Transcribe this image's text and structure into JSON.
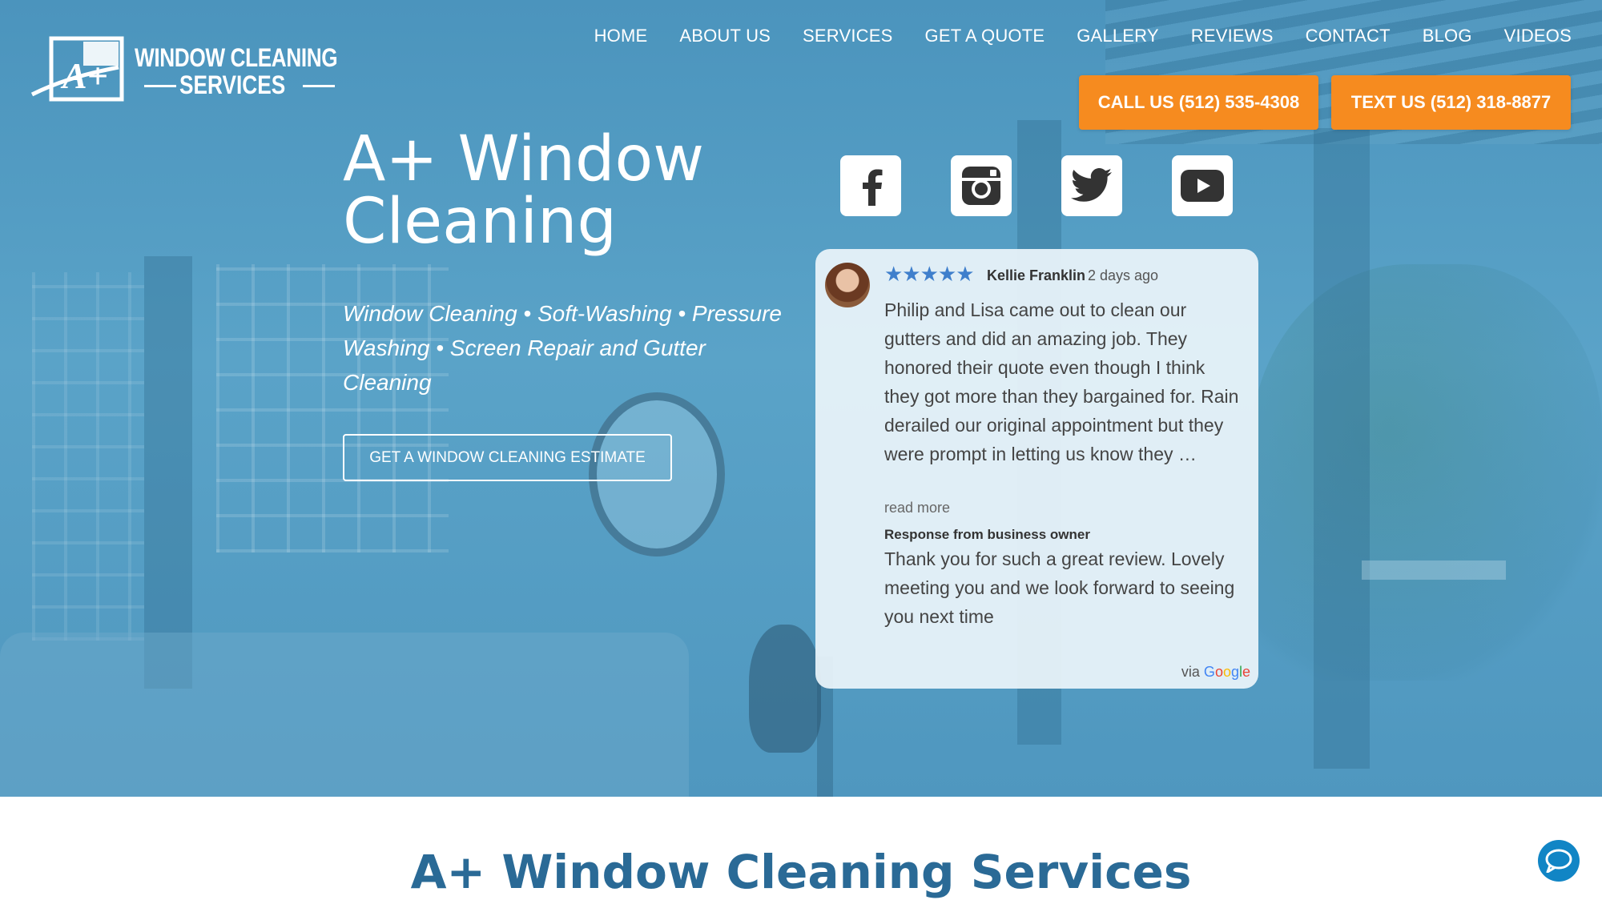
{
  "brand": {
    "logo_line1": "WINDOW CLEANING",
    "logo_line2": "SERVICES",
    "logo_mark": "A+",
    "accent_color": "#f68b1f",
    "hero_overlay_color": "#4b94bd"
  },
  "nav": {
    "items": [
      "HOME",
      "ABOUT US",
      "SERVICES",
      "GET A QUOTE",
      "GALLERY",
      "REVIEWS",
      "CONTACT",
      "BLOG",
      "VIDEOS"
    ]
  },
  "cta": {
    "call_label": "CALL US (512) 535-4308",
    "text_label": "TEXT US (512) 318-8877"
  },
  "hero": {
    "headline": "A+ Window Cleaning",
    "tagline": "Window Cleaning • Soft-Washing • Pressure Washing • Screen Repair and Gutter Cleaning",
    "estimate_button": "GET A WINDOW CLEANING ESTIMATE"
  },
  "social": [
    {
      "icon": "facebook-icon"
    },
    {
      "icon": "instagram-icon"
    },
    {
      "icon": "twitter-icon"
    },
    {
      "icon": "youtube-icon"
    }
  ],
  "review": {
    "stars": "★★★★★",
    "rating": 5,
    "reviewer": "Kellie Franklin",
    "time": "2 days ago",
    "body": "Philip and Lisa came out to clean our gutters and did an amazing job. They honored their quote even though I think they got more than they bargained for. Rain derailed our original appointment but they were prompt in letting us know they …",
    "read_more": "read more",
    "response_heading": "Response from business owner",
    "response": "Thank you for such a great review. Lovely meeting you and we look forward to seeing you next time",
    "via": "via",
    "source": "Google"
  },
  "section": {
    "title": "A+ Window Cleaning Services"
  },
  "chat": {
    "icon": "chat-bubble-icon"
  }
}
